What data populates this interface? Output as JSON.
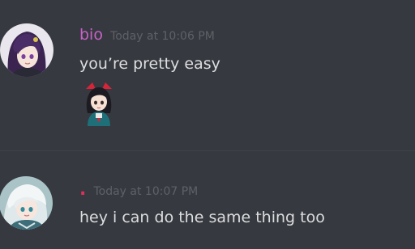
{
  "messages": [
    {
      "username": "bio",
      "timestamp": "Today at 10:06 PM",
      "text": "you’re pretty easy",
      "username_color": "#c862c8",
      "avatar_icon": "purple-haired-anime-avatar",
      "attachment_icon": "anime-girl-emote"
    },
    {
      "username": ".",
      "timestamp": "Today at 10:07 PM",
      "text": "hey i can do the same thing too",
      "username_color": "#e0305a",
      "avatar_icon": "white-haired-anime-avatar"
    }
  ],
  "colors": {
    "background": "#36393f",
    "message_text": "#dcddde",
    "timestamp": "#5e6167"
  }
}
